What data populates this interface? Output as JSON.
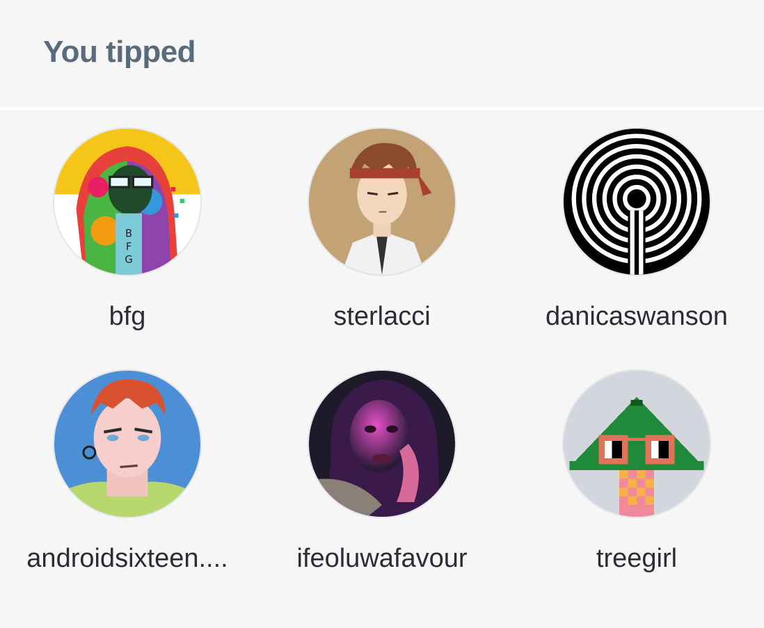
{
  "section": {
    "title": "You tipped"
  },
  "users": [
    {
      "name": "bfg",
      "avatar_icon": "rainbow-hoodie-avatar"
    },
    {
      "name": "sterlacci",
      "avatar_icon": "anime-headband-avatar"
    },
    {
      "name": "danicaswanson",
      "avatar_icon": "labyrinth-avatar"
    },
    {
      "name": "androidsixteen....",
      "avatar_icon": "redhead-android-avatar"
    },
    {
      "name": "ifeoluwafavour",
      "avatar_icon": "portrait-photo-avatar"
    },
    {
      "name": "treegirl",
      "avatar_icon": "pixel-tree-avatar"
    }
  ],
  "colors": {
    "title": "#5a6b7c",
    "text": "#2a2d33",
    "background": "#f6f6f7"
  }
}
